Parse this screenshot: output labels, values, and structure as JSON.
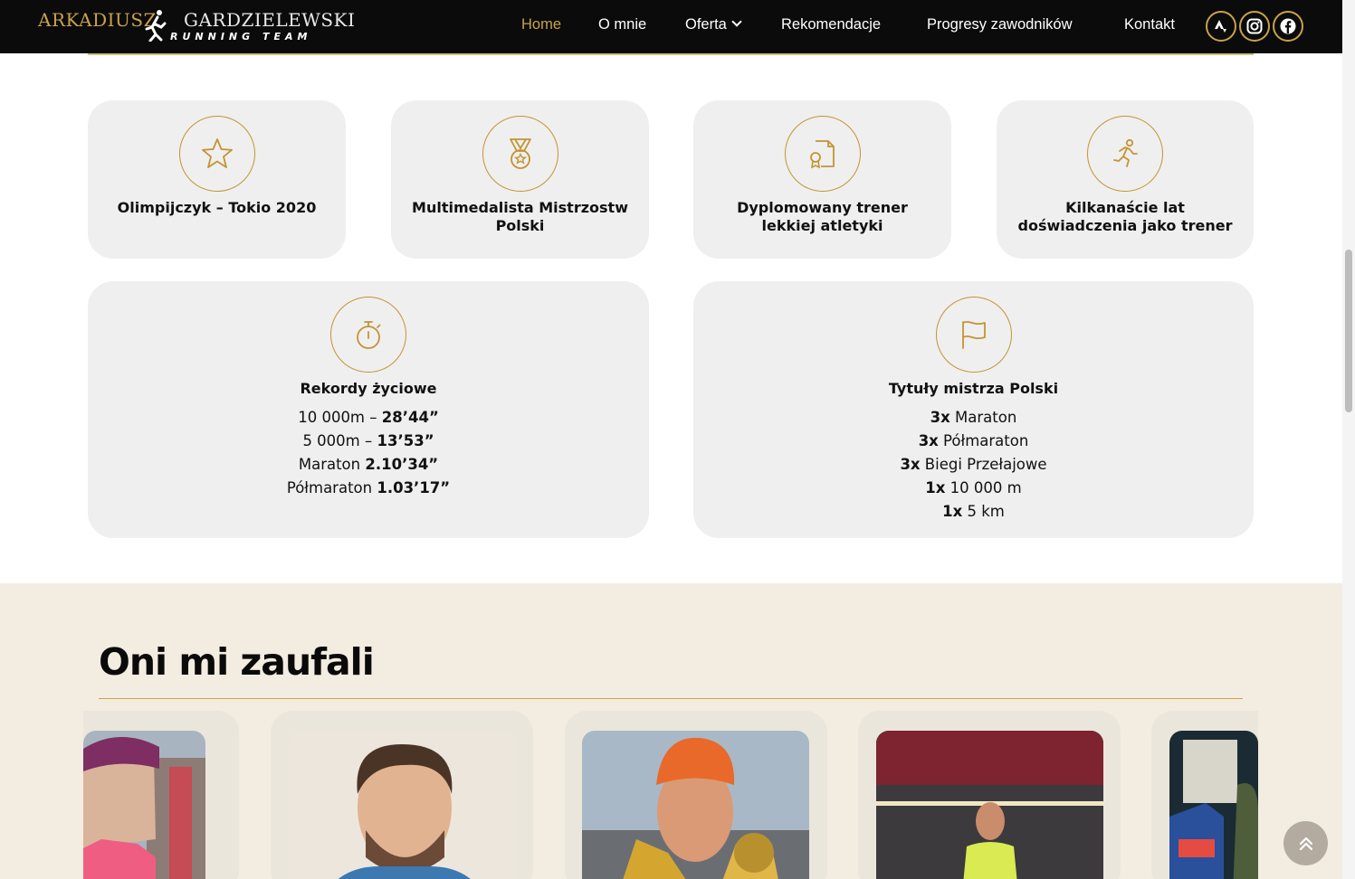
{
  "header": {
    "logo_top_gold": "ARKADIUSZ",
    "logo_top_white": "GARDZIELEWSKI",
    "logo_bottom": "RUNNING TEAM",
    "nav": [
      "Home",
      "O mnie",
      "Oferta",
      "Rekomendacje",
      "Progresy zawodników",
      "Kontakt"
    ],
    "active_nav": "Home",
    "social_icons": [
      "strava-icon",
      "instagram-icon",
      "facebook-icon"
    ]
  },
  "features": [
    {
      "icon": "star-icon",
      "title": "Olimpijczyk – Tokio 2020"
    },
    {
      "icon": "medal-icon",
      "title": "Multimedalista Mistrzostw Polski"
    },
    {
      "icon": "certificate-icon",
      "title": "Dyplomowany trener lekkiej atletyki"
    },
    {
      "icon": "runner-icon",
      "title": "Kilkanaście lat doświadczenia jako trener"
    }
  ],
  "records": {
    "icon": "stopwatch-icon",
    "title": "Rekordy życiowe",
    "lines": [
      {
        "label": "10 000m – ",
        "value": "28’44”"
      },
      {
        "label": "5 000m – ",
        "value": "13’53”"
      },
      {
        "label": "Maraton ",
        "value": "2.10’34”"
      },
      {
        "label": "Półmaraton ",
        "value": "1.03’17”"
      }
    ]
  },
  "titles": {
    "icon": "flag-icon",
    "title": "Tytuły mistrza Polski",
    "lines": [
      {
        "count": "3x",
        "label": " Maraton"
      },
      {
        "count": "3x",
        "label": " Półmaraton"
      },
      {
        "count": "3x",
        "label": " Biegi Przełajowe"
      },
      {
        "count": "1x",
        "label": " 10 000 m"
      },
      {
        "count": "1x",
        "label": " 5 km"
      }
    ]
  },
  "testimonials": {
    "heading": "Oni mi zaufali"
  },
  "colors": {
    "accent": "#c39433",
    "header_bg": "#0b0b0b",
    "card_bg": "#efefef",
    "beige_bg": "#f3ece0"
  }
}
